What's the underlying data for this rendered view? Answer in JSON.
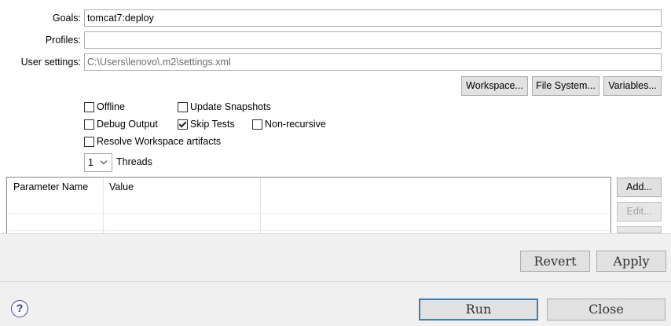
{
  "form": {
    "goals_label": "Goals:",
    "goals_value": "tomcat7:deploy",
    "profiles_label": "Profiles:",
    "profiles_value": "",
    "user_settings_label": "User settings:",
    "user_settings_value": "C:\\Users\\lenovo\\.m2\\settings.xml"
  },
  "settings_buttons": {
    "workspace": "Workspace...",
    "file_system": "File System...",
    "variables": "Variables..."
  },
  "options": {
    "offline": {
      "label": "Offline",
      "checked": false
    },
    "update_snapshots": {
      "label": "Update Snapshots",
      "checked": false
    },
    "debug_output": {
      "label": "Debug Output",
      "checked": false
    },
    "skip_tests": {
      "label": "Skip Tests",
      "checked": true
    },
    "non_recursive": {
      "label": "Non-recursive",
      "checked": false
    },
    "resolve_workspace": {
      "label": "Resolve Workspace artifacts",
      "checked": false
    }
  },
  "threads": {
    "value": "1",
    "label": "Threads"
  },
  "parameters_table": {
    "columns": [
      "Parameter Name",
      "Value"
    ],
    "rows": []
  },
  "parameter_buttons": {
    "add": "Add...",
    "edit": "Edit..."
  },
  "footer": {
    "revert": "Revert",
    "apply": "Apply",
    "run": "Run",
    "close": "Close",
    "help_icon_glyph": "?"
  },
  "colors": {
    "default_button_border": "#3c7fb1",
    "window_bg": "#f0f0f0",
    "panel_bg": "#ffffff"
  }
}
